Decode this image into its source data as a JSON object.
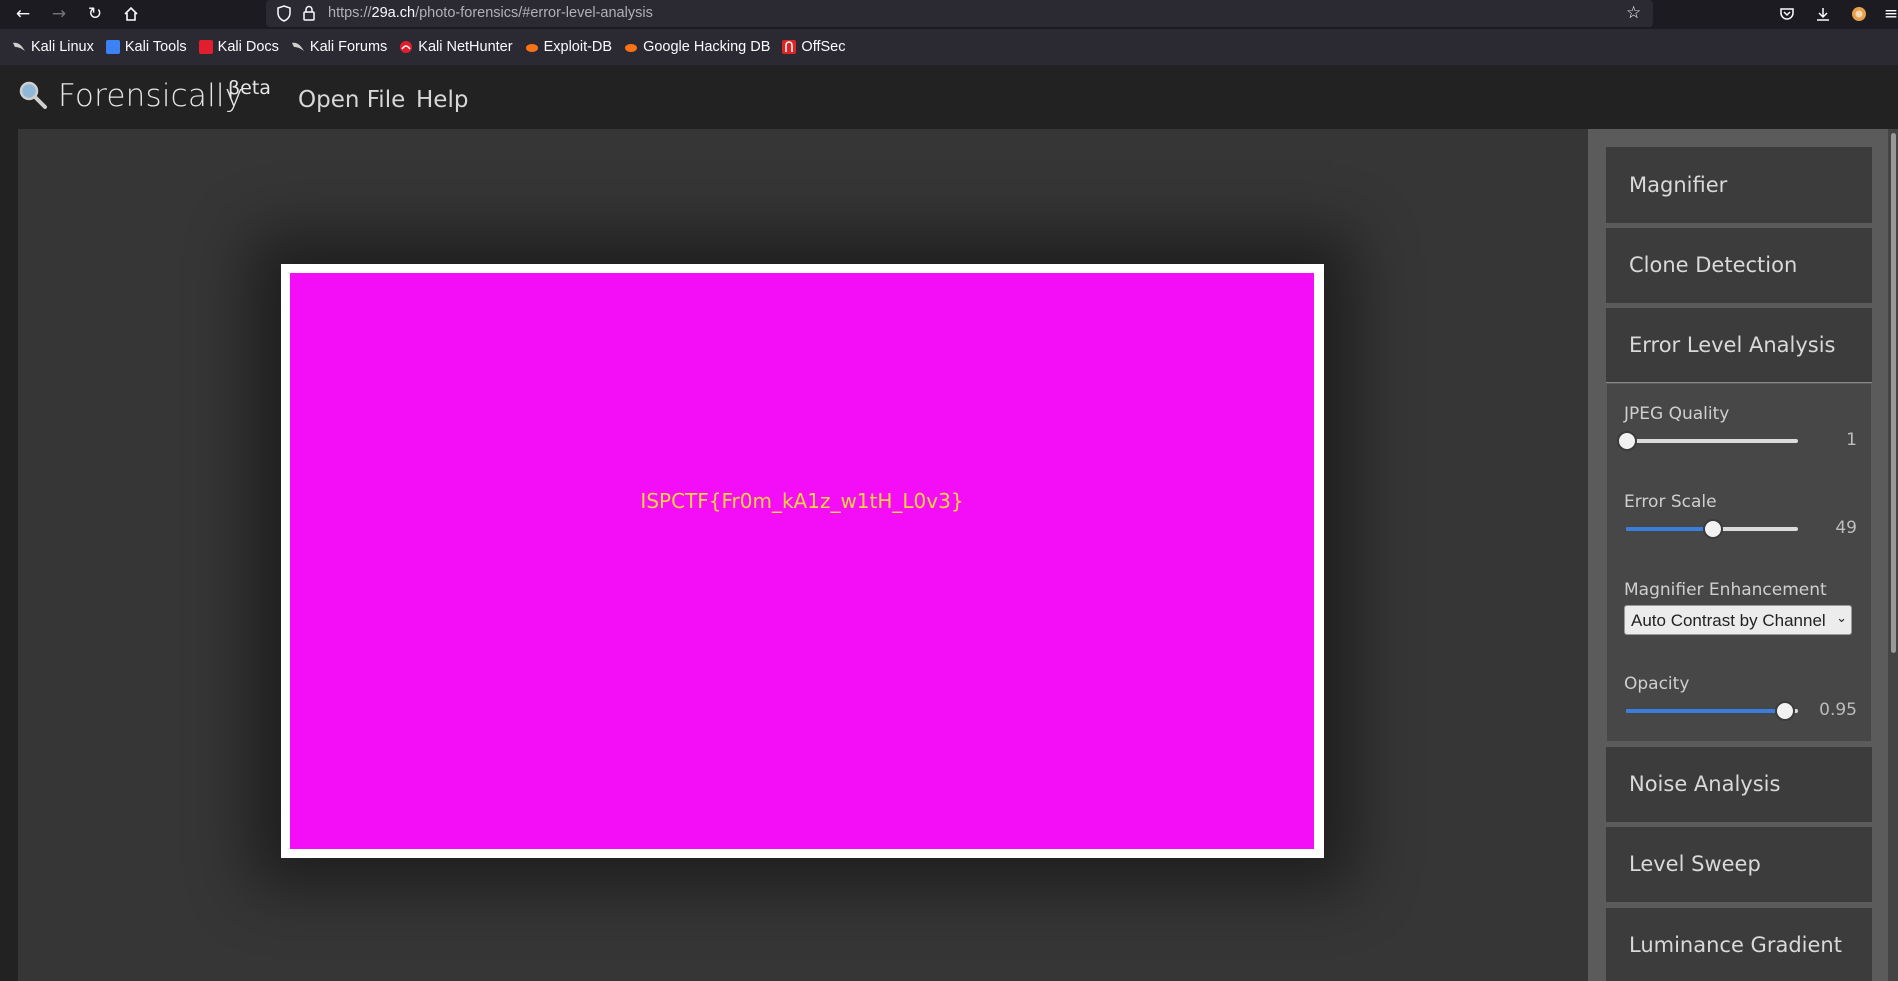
{
  "browser": {
    "url_scheme": "https://",
    "url_host": "29a.ch",
    "url_path": "/photo-forensics/#error-level-analysis",
    "bookmarks": [
      {
        "label": "Kali Linux",
        "icon": "kali-dragon-icon",
        "color": "#cfcfcf"
      },
      {
        "label": "Kali Tools",
        "icon": "kali-tools-icon",
        "color": "#3b82f6"
      },
      {
        "label": "Kali Docs",
        "icon": "kali-docs-icon",
        "color": "#e11d2e"
      },
      {
        "label": "Kali Forums",
        "icon": "kali-forums-icon",
        "color": "#cfcfcf"
      },
      {
        "label": "Kali NetHunter",
        "icon": "nethunter-icon",
        "color": "#e11d2e"
      },
      {
        "label": "Exploit-DB",
        "icon": "exploit-db-icon",
        "color": "#f97316"
      },
      {
        "label": "Google Hacking DB",
        "icon": "ghdb-icon",
        "color": "#f97316"
      },
      {
        "label": "OffSec",
        "icon": "offsec-icon",
        "color": "#dc2626"
      }
    ]
  },
  "app": {
    "title": "Forensically",
    "beta": "βeta",
    "nav": {
      "open_file": "Open File",
      "help": "Help"
    }
  },
  "image": {
    "background_color": "#f40ef7",
    "flag_text": "ISPCTF{Fr0m_kA1z_w1tH_L0v3}"
  },
  "sidebar": {
    "panels": {
      "magnifier": "Magnifier",
      "clone_detection": "Clone Detection",
      "error_level_analysis": "Error Level Analysis",
      "noise_analysis": "Noise Analysis",
      "level_sweep": "Level Sweep",
      "luminance_gradient": "Luminance Gradient"
    },
    "ela": {
      "jpeg_quality": {
        "label": "JPEG Quality",
        "value": "1",
        "fraction": 0.0
      },
      "error_scale": {
        "label": "Error Scale",
        "value": "49",
        "fraction": 0.5
      },
      "magnifier_enhancement": {
        "label": "Magnifier Enhancement",
        "selected": "Auto Contrast by Channel"
      },
      "opacity": {
        "label": "Opacity",
        "value": "0.95",
        "fraction": 0.92
      }
    },
    "accent_color": "#3b7ddd"
  }
}
